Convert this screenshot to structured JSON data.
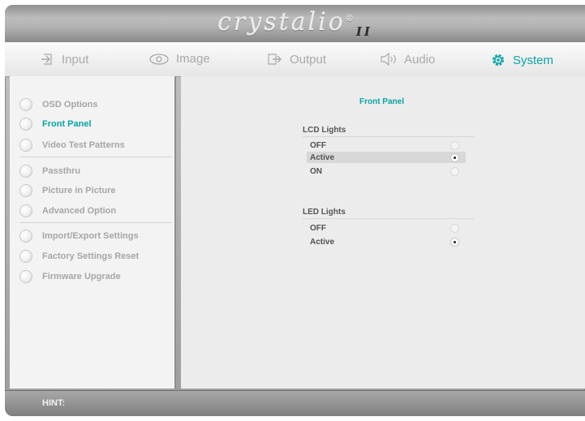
{
  "header": {
    "logo_text": "crystalio",
    "logo_suffix": "II"
  },
  "tabs": [
    {
      "label": "Input",
      "icon": "input-icon",
      "active": false
    },
    {
      "label": "Image",
      "icon": "eye-icon",
      "active": false
    },
    {
      "label": "Output",
      "icon": "output-icon",
      "active": false
    },
    {
      "label": "Audio",
      "icon": "speaker-icon",
      "active": false
    },
    {
      "label": "System",
      "icon": "gear-icon",
      "active": true
    }
  ],
  "sidebar": {
    "items": [
      {
        "label": "OSD Options",
        "active": false
      },
      {
        "label": "Front Panel",
        "active": true
      },
      {
        "label": "Video Test Patterns",
        "active": false
      },
      {
        "label": "Passthru",
        "active": false
      },
      {
        "label": "Picture in Picture",
        "active": false
      },
      {
        "label": "Advanced Option",
        "active": false
      },
      {
        "label": "Import/Export Settings",
        "active": false
      },
      {
        "label": "Factory Settings Reset",
        "active": false
      },
      {
        "label": "Firmware Upgrade",
        "active": false
      }
    ]
  },
  "main": {
    "title": "Front Panel",
    "groups": [
      {
        "title": "LCD Lights",
        "options": [
          {
            "label": "OFF",
            "selected": false
          },
          {
            "label": "Active",
            "selected": true
          },
          {
            "label": "ON",
            "selected": false
          }
        ]
      },
      {
        "title": "LED Lights",
        "options": [
          {
            "label": "OFF",
            "selected": false
          },
          {
            "label": "Active",
            "selected": true
          }
        ]
      }
    ]
  },
  "hint": {
    "label": "HINT:"
  },
  "colors": {
    "accent": "#0aa3a4",
    "inactive_text": "#a6a6a6"
  }
}
